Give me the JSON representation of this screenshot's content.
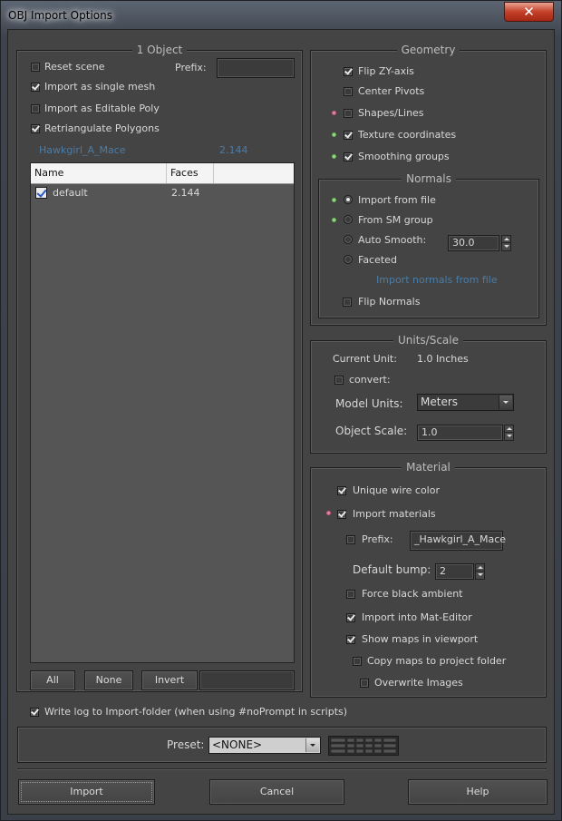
{
  "window": {
    "title": "OBJ Import Options",
    "close_glyph": "✕"
  },
  "object_group": {
    "title": "1 Object",
    "reset_scene": {
      "label": "Reset scene",
      "checked": false
    },
    "prefix_label": "Prefix:",
    "prefix_value": "",
    "import_single_mesh": {
      "label": "Import as single mesh",
      "checked": true
    },
    "import_editable_poly": {
      "label": "Import as Editable Poly",
      "checked": false
    },
    "retriangulate": {
      "label": "Retriangulate Polygons",
      "checked": true
    },
    "object_name": "Hawkgirl_A_Mace",
    "object_faces": "2.144",
    "list": {
      "columns": [
        "Name",
        "Faces"
      ],
      "rows": [
        {
          "name": "default",
          "faces": "2.144",
          "checked": true
        }
      ]
    },
    "buttons": {
      "all": "All",
      "none": "None",
      "invert": "Invert"
    },
    "filter_value": ""
  },
  "geometry": {
    "title": "Geometry",
    "flip_zy": {
      "label": "Flip ZY-axis",
      "checked": true
    },
    "center_pivots": {
      "label": "Center Pivots",
      "checked": false
    },
    "shapes_lines": {
      "label": "Shapes/Lines",
      "checked": false
    },
    "texture_coords": {
      "label": "Texture coordinates",
      "checked": true
    },
    "smoothing_groups": {
      "label": "Smoothing groups",
      "checked": true
    }
  },
  "normals": {
    "title": "Normals",
    "import_from_file": "Import from file",
    "from_sm_group": "From SM group",
    "auto_smooth": "Auto Smooth:",
    "auto_smooth_value": "30.0",
    "faceted": "Faceted",
    "status": "Import normals from file",
    "flip_normals": {
      "label": "Flip Normals",
      "checked": false
    }
  },
  "units": {
    "title": "Units/Scale",
    "current_unit_label": "Current Unit:",
    "current_unit_value": "1.0 Inches",
    "convert": {
      "label": "convert:",
      "checked": false
    },
    "model_units_label": "Model Units:",
    "model_units_value": "Meters",
    "object_scale_label": "Object Scale:",
    "object_scale_value": "1.0"
  },
  "material": {
    "title": "Material",
    "unique_wire": {
      "label": "Unique wire color",
      "checked": true
    },
    "import_materials": {
      "label": "Import materials",
      "checked": true
    },
    "prefix": {
      "label": "Prefix:",
      "checked": false
    },
    "prefix_value": "_Hawkgirl_A_Mace",
    "default_bump_label": "Default bump:",
    "default_bump_value": "2",
    "force_black_ambient": {
      "label": "Force black ambient",
      "checked": false
    },
    "import_mat_editor": {
      "label": "Import into Mat-Editor",
      "checked": true
    },
    "show_maps": {
      "label": "Show maps in viewport",
      "checked": true
    },
    "copy_maps": {
      "label": "Copy maps to project folder",
      "checked": false
    },
    "overwrite_images": {
      "label": "Overwrite Images",
      "checked": false
    }
  },
  "write_log": {
    "label": "Write log to Import-folder (when using #noPrompt in scripts)",
    "checked": true
  },
  "preset": {
    "label": "Preset:",
    "value": "<NONE>"
  },
  "footer": {
    "import": "Import",
    "cancel": "Cancel",
    "help": "Help"
  }
}
